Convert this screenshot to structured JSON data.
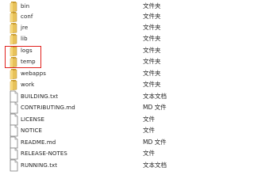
{
  "files": [
    {
      "name": "bin",
      "type": "文件夹",
      "kind": "folder-icon"
    },
    {
      "name": "conf",
      "type": "文件夹",
      "kind": "folder-icon"
    },
    {
      "name": "jre",
      "type": "文件夹",
      "kind": "folder-icon"
    },
    {
      "name": "lib",
      "type": "文件夹",
      "kind": "folder-icon"
    },
    {
      "name": "logs",
      "type": "文件夹",
      "kind": "folder-icon"
    },
    {
      "name": "temp",
      "type": "文件夹",
      "kind": "folder-icon"
    },
    {
      "name": "webapps",
      "type": "文件夹",
      "kind": "folder-icon"
    },
    {
      "name": "work",
      "type": "文件夹",
      "kind": "folder-icon"
    },
    {
      "name": "BUILDING.txt",
      "type": "文本文档",
      "kind": "document-icon"
    },
    {
      "name": "CONTRIBUTING.md",
      "type": "MD 文件",
      "kind": "document-icon"
    },
    {
      "name": "LICENSE",
      "type": "文件",
      "kind": "document-icon"
    },
    {
      "name": "NOTICE",
      "type": "文件",
      "kind": "document-icon"
    },
    {
      "name": "README.md",
      "type": "MD 文件",
      "kind": "document-icon"
    },
    {
      "name": "RELEASE-NOTES",
      "type": "文件",
      "kind": "document-icon"
    },
    {
      "name": "RUNNING.txt",
      "type": "文本文档",
      "kind": "document-icon"
    }
  ],
  "colors": {
    "folder": "#e8c25a",
    "folder_dark": "#c99a2a",
    "highlight": "#e0201c"
  }
}
